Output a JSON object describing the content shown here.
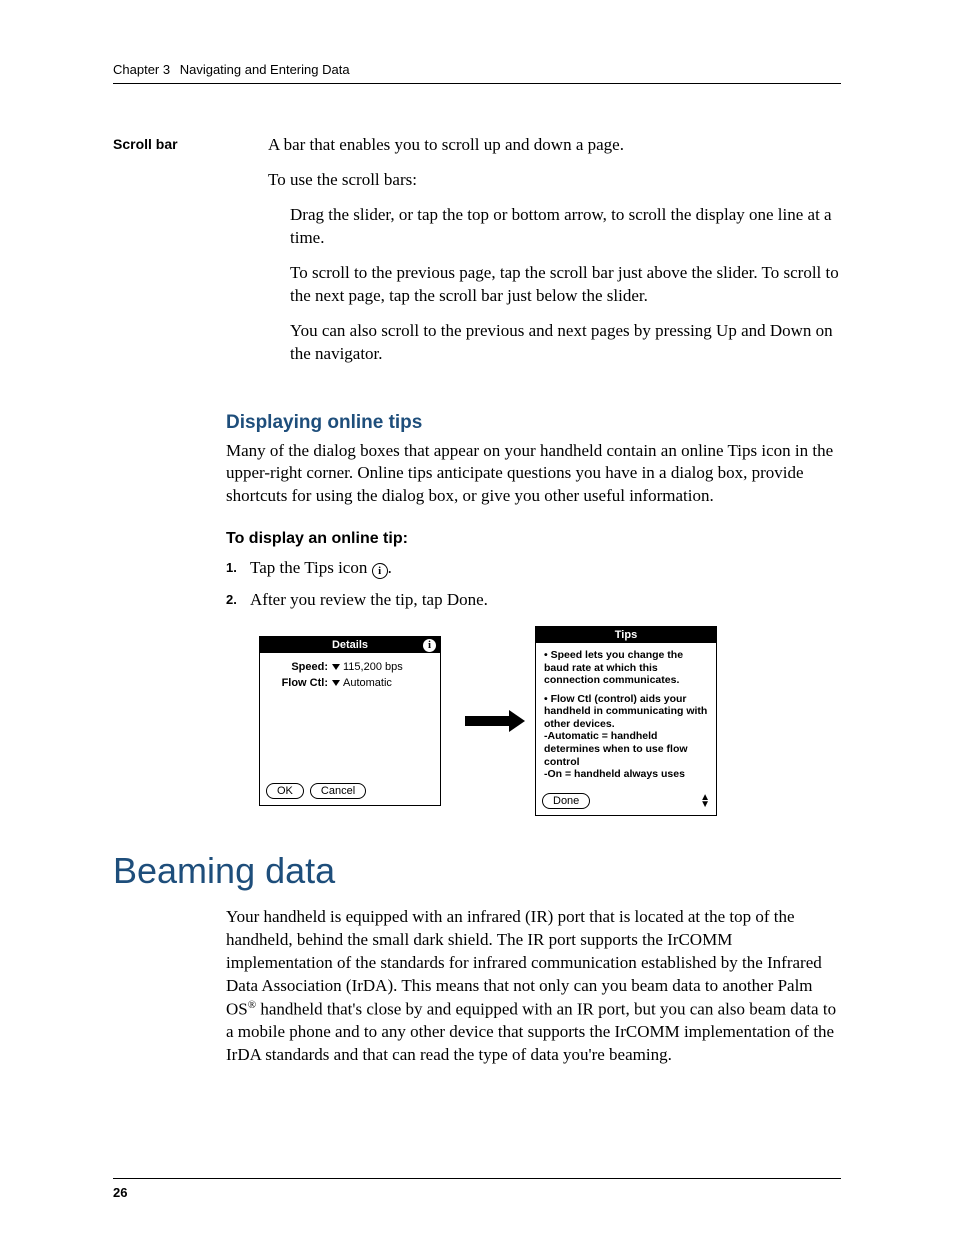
{
  "header": {
    "chapter": "Chapter 3",
    "title": "Navigating and Entering Data"
  },
  "term": {
    "label": "Scroll bar",
    "def": "A bar that enables you to scroll up and down a page.",
    "p2": "To use the scroll bars:",
    "p3": "Drag the slider, or tap the top or bottom arrow, to scroll the display one line at a time.",
    "p4": "To scroll to the previous page, tap the scroll bar just above the slider. To scroll to the next page, tap the scroll bar just below the slider.",
    "p5": "You can also scroll to the previous and next pages by pressing Up and Down on the navigator."
  },
  "tips_section": {
    "heading": "Displaying online tips",
    "body": "Many of the dialog boxes that appear on your handheld contain an online Tips icon in the upper-right corner. Online tips anticipate questions you have in a dialog box, provide shortcuts for using the dialog box, or give you other useful information.",
    "proc_head": "To display an online tip:",
    "step1_num": "1.",
    "step1": "Tap the Tips icon ",
    "step1_tail": ".",
    "step2_num": "2.",
    "step2": "After you review the tip, tap Done."
  },
  "details_dialog": {
    "title": "Details",
    "speed_label": "Speed:",
    "speed_value": "115,200 bps",
    "flow_label": "Flow Ctl:",
    "flow_value": "Automatic",
    "ok": "OK",
    "cancel": "Cancel"
  },
  "tips_dialog": {
    "title": "Tips",
    "line1": "• Speed lets you change the baud rate at which this connection communicates.",
    "line2": "• Flow Ctl (control) aids your handheld in communicating with other devices.",
    "line3": "-Automatic = handheld determines when to use flow control",
    "line4": "-On = handheld always uses",
    "done": "Done"
  },
  "beaming": {
    "heading": "Beaming data",
    "body1": "Your handheld is equipped with an infrared (IR) port that is located at the top of the handheld, behind the small dark shield. The IR port supports the IrCOMM implementation of the standards for infrared communication established by the Infrared Data Association (IrDA). This means that not only can you beam data to another Palm OS",
    "body2": " handheld that's close by and equipped with an IR port, but you can also beam data to a mobile phone and to any other device that supports the IrCOMM implementation of the IrDA standards and that can read the type of data you're beaming."
  },
  "page_number": "26"
}
